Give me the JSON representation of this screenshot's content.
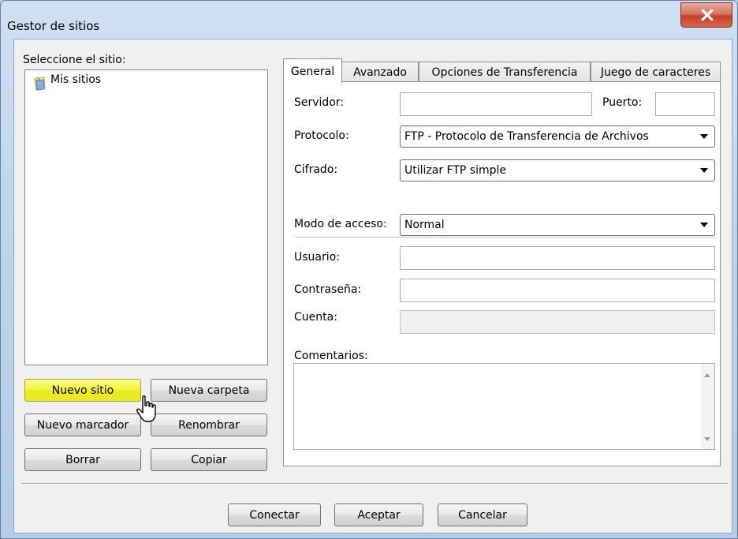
{
  "window": {
    "title": "Gestor de sitios",
    "close_glyph": "X"
  },
  "left_panel": {
    "select_label": "Seleccione el sitio:",
    "tree_root": "Mis sitios",
    "buttons": {
      "new_site": "Nuevo sitio",
      "new_folder": "Nueva carpeta",
      "new_bookmark": "Nuevo marcador",
      "rename": "Renombrar",
      "delete": "Borrar",
      "copy": "Copiar"
    }
  },
  "tabs": [
    {
      "label": "General",
      "active": true
    },
    {
      "label": "Avanzado",
      "active": false
    },
    {
      "label": "Opciones de Transferencia",
      "active": false
    },
    {
      "label": "Juego de caracteres",
      "active": false
    }
  ],
  "general": {
    "server_label": "Servidor:",
    "server_value": "",
    "port_label": "Puerto:",
    "port_value": "",
    "protocol_label": "Protocolo:",
    "protocol_value": "FTP - Protocolo de Transferencia de Archivos",
    "encryption_label": "Cifrado:",
    "encryption_value": "Utilizar FTP simple",
    "logon_label": "Modo de acceso:",
    "logon_value": "Normal",
    "user_label": "Usuario:",
    "user_value": "",
    "password_label": "Contraseña:",
    "password_value": "",
    "account_label": "Cuenta:",
    "account_value": "",
    "comments_label": "Comentarios:",
    "comments_value": ""
  },
  "footer": {
    "connect": "Conectar",
    "accept": "Aceptar",
    "cancel": "Cancelar"
  },
  "colors": {
    "title_bar": "#bcd3ec",
    "close_button": "#c4402a",
    "hover_button": "#f4f33c"
  },
  "icons": [
    "close-icon",
    "folder-icon",
    "dropdown-arrow-icon",
    "mouse-cursor-icon"
  ]
}
